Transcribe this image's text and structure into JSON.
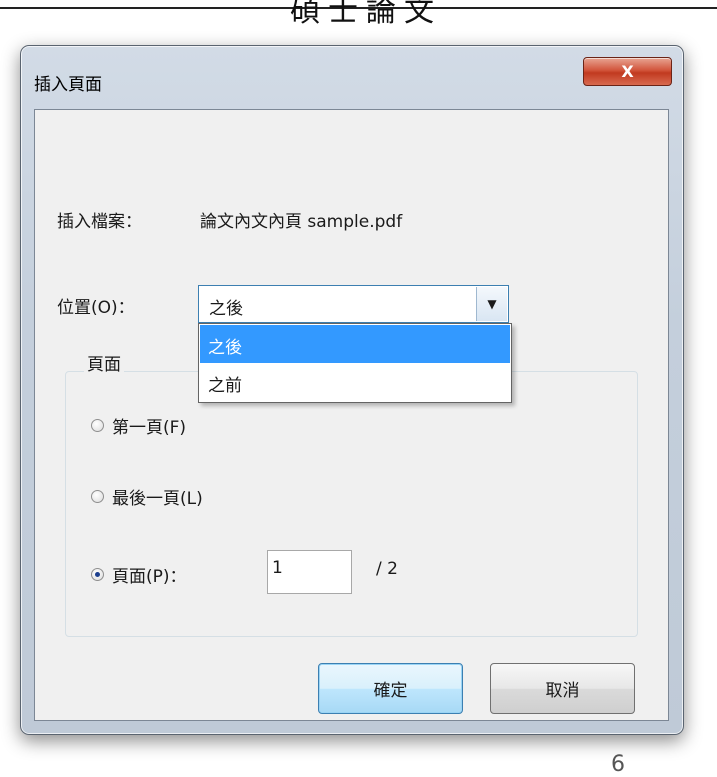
{
  "background": {
    "title": "碩士論文",
    "page_number": "6"
  },
  "dialog": {
    "title": "插入頁面",
    "close_label": "X",
    "file_label": "插入檔案：",
    "file_name": "論文內文內頁 sample.pdf",
    "position_label": "位置(O)：",
    "position_value": "之後",
    "position_options": [
      "之後",
      "之前"
    ],
    "page_group_label": "頁面",
    "radios": {
      "first": "第一頁(F)",
      "last": "最後一頁(L)",
      "page": "頁面(P)："
    },
    "selected_radio": "page",
    "page_input_value": "1",
    "page_total": "/ 2",
    "ok_label": "確定",
    "cancel_label": "取消"
  },
  "colors": {
    "selection": "#3399ff",
    "close_button": "#c13a20",
    "focus_border": "#3c7fb1"
  }
}
